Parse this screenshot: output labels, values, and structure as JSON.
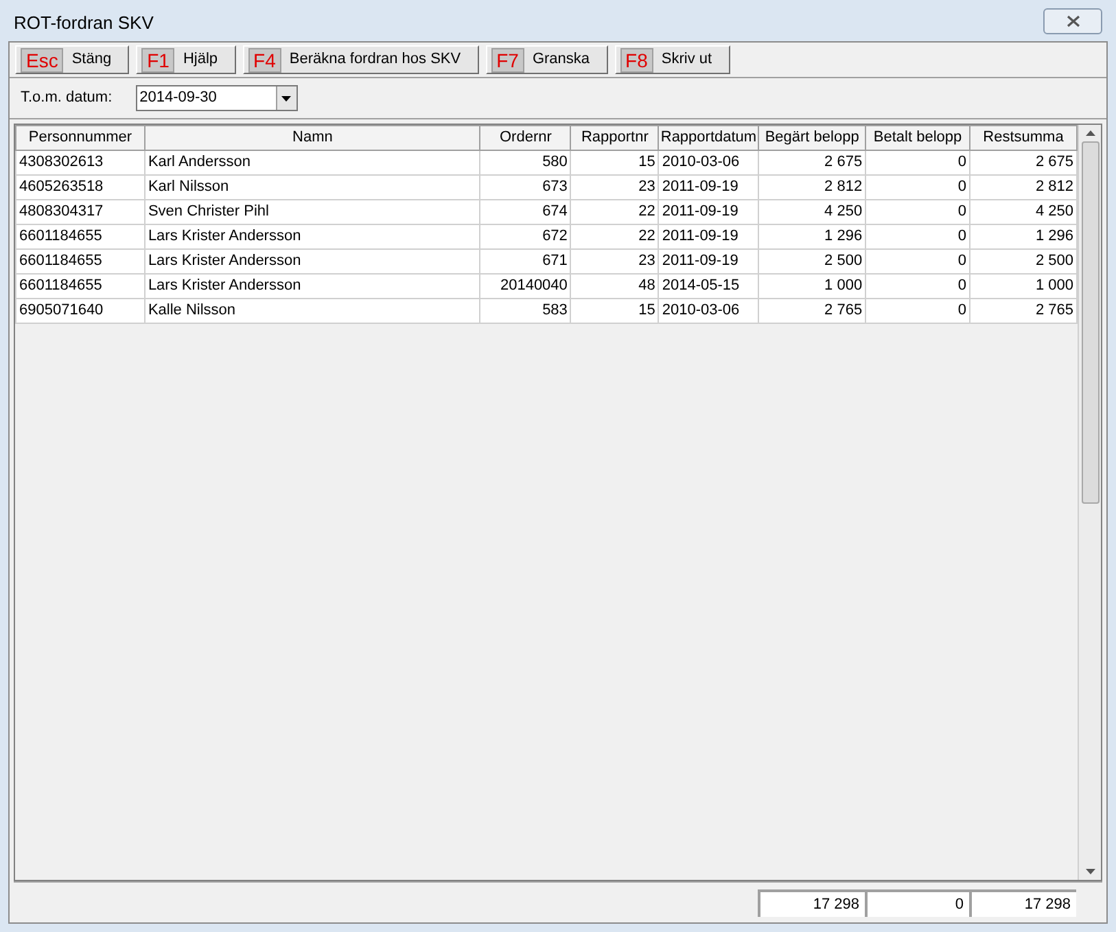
{
  "window": {
    "title": "ROT-fordran SKV"
  },
  "toolbar": [
    {
      "key": "Esc",
      "label": "Stäng"
    },
    {
      "key": "F1",
      "label": "Hjälp"
    },
    {
      "key": "F4",
      "label": "Beräkna fordran hos SKV"
    },
    {
      "key": "F7",
      "label": "Granska"
    },
    {
      "key": "F8",
      "label": "Skriv ut"
    }
  ],
  "date_filter": {
    "label": "T.o.m. datum:",
    "value": "2014-09-30"
  },
  "table": {
    "columns": [
      {
        "label": "Personnummer"
      },
      {
        "label": "Namn"
      },
      {
        "label": "Ordernr"
      },
      {
        "label": "Rapportnr"
      },
      {
        "label": "Rapportdatum"
      },
      {
        "label": "Begärt belopp"
      },
      {
        "label": "Betalt belopp"
      },
      {
        "label": "Restsumma"
      }
    ],
    "rows": [
      [
        "4308302613",
        "Karl Andersson",
        "580",
        "15",
        "2010-03-06",
        "2 675",
        "0",
        "2 675"
      ],
      [
        "4605263518",
        "Karl Nilsson",
        "673",
        "23",
        "2011-09-19",
        "2 812",
        "0",
        "2 812"
      ],
      [
        "4808304317",
        "Sven Christer Pihl",
        "674",
        "22",
        "2011-09-19",
        "4 250",
        "0",
        "4 250"
      ],
      [
        "6601184655",
        "Lars Krister Andersson",
        "672",
        "22",
        "2011-09-19",
        "1 296",
        "0",
        "1 296"
      ],
      [
        "6601184655",
        "Lars Krister Andersson",
        "671",
        "23",
        "2011-09-19",
        "2 500",
        "0",
        "2 500"
      ],
      [
        "6601184655",
        "Lars Krister Andersson",
        "20140040",
        "48",
        "2014-05-15",
        "1 000",
        "0",
        "1 000"
      ],
      [
        "6905071640",
        "Kalle Nilsson",
        "583",
        "15",
        "2010-03-06",
        "2 765",
        "0",
        "2 765"
      ]
    ]
  },
  "totals": [
    "17 298",
    "0",
    "17 298"
  ]
}
